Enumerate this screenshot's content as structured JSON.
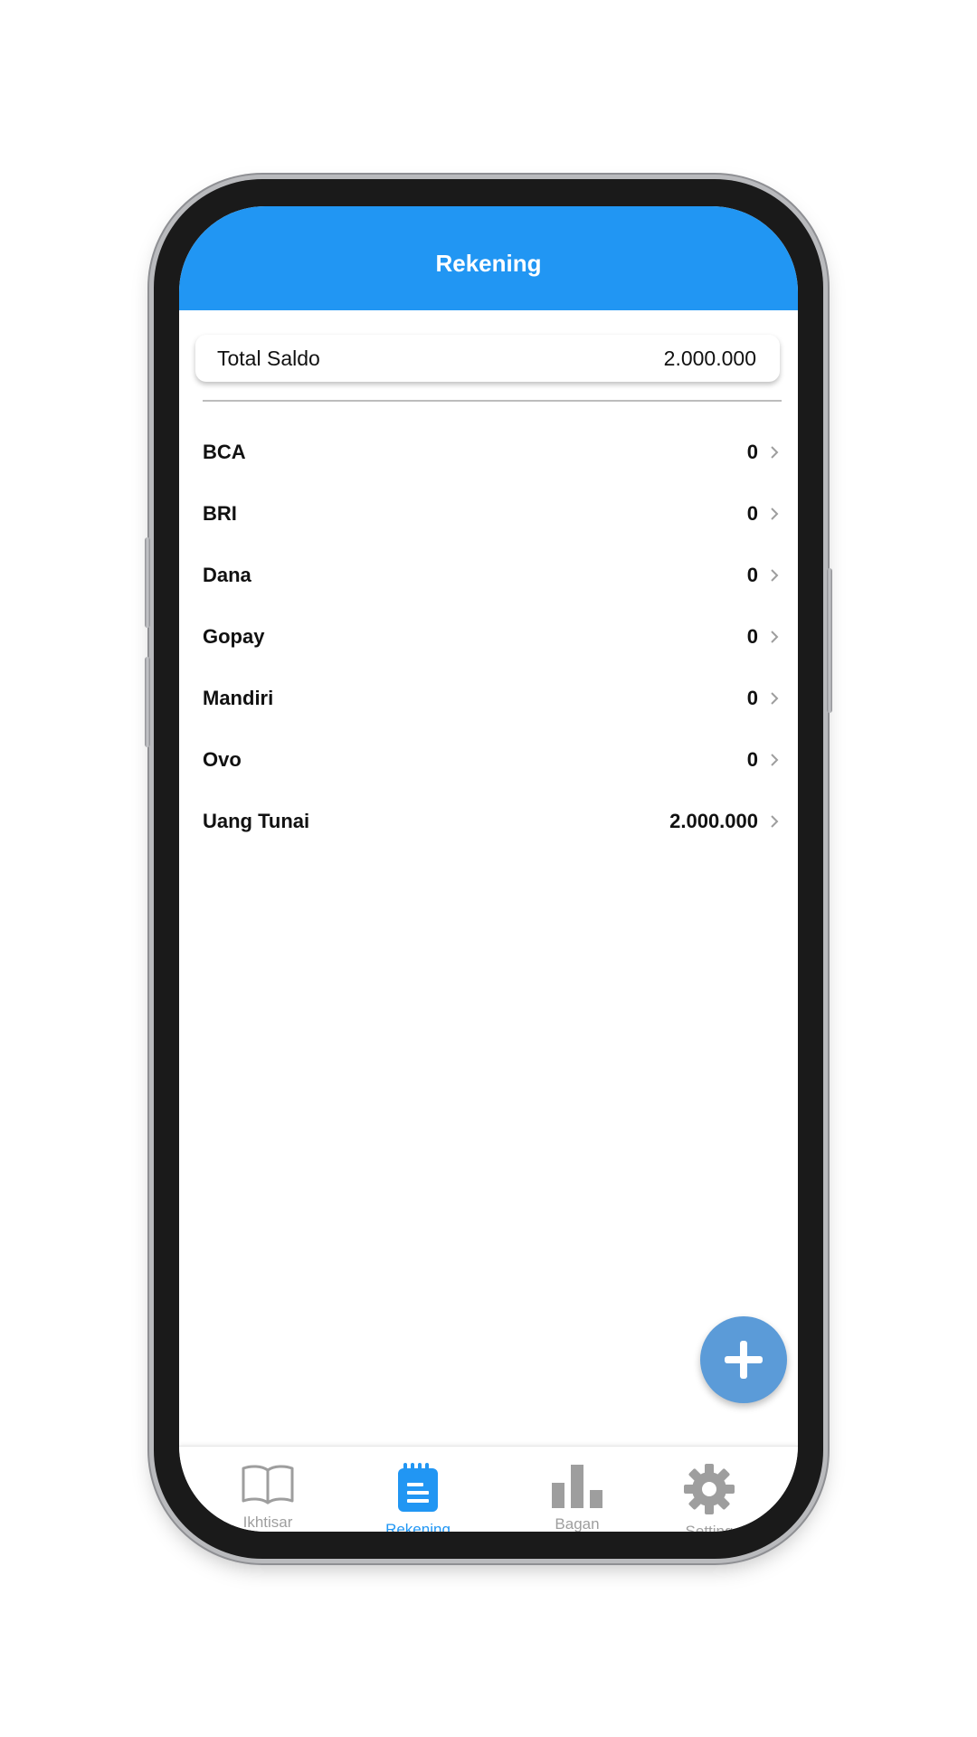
{
  "appbar": {
    "title": "Rekening",
    "color": "#2196f3"
  },
  "total": {
    "label": "Total Saldo",
    "value": "2.000.000"
  },
  "accounts": [
    {
      "name": "BCA",
      "balance": "0"
    },
    {
      "name": "BRI",
      "balance": "0"
    },
    {
      "name": "Dana",
      "balance": "0"
    },
    {
      "name": "Gopay",
      "balance": "0"
    },
    {
      "name": "Mandiri",
      "balance": "0"
    },
    {
      "name": "Ovo",
      "balance": "0"
    },
    {
      "name": "Uang Tunai",
      "balance": "2.000.000"
    }
  ],
  "fab": {
    "icon": "plus-icon",
    "color": "#5b9bd8"
  },
  "bottom_nav": {
    "items": [
      {
        "label": "Ikhtisar",
        "icon": "book-icon",
        "active": false
      },
      {
        "label": "Rekening",
        "icon": "notepad-icon",
        "active": true
      },
      {
        "label": "Bagan",
        "icon": "bar-chart-icon",
        "active": false
      },
      {
        "label": "Setting",
        "icon": "gear-icon",
        "active": false
      }
    ],
    "active_color": "#2196f3",
    "inactive_color": "#9e9e9e"
  }
}
